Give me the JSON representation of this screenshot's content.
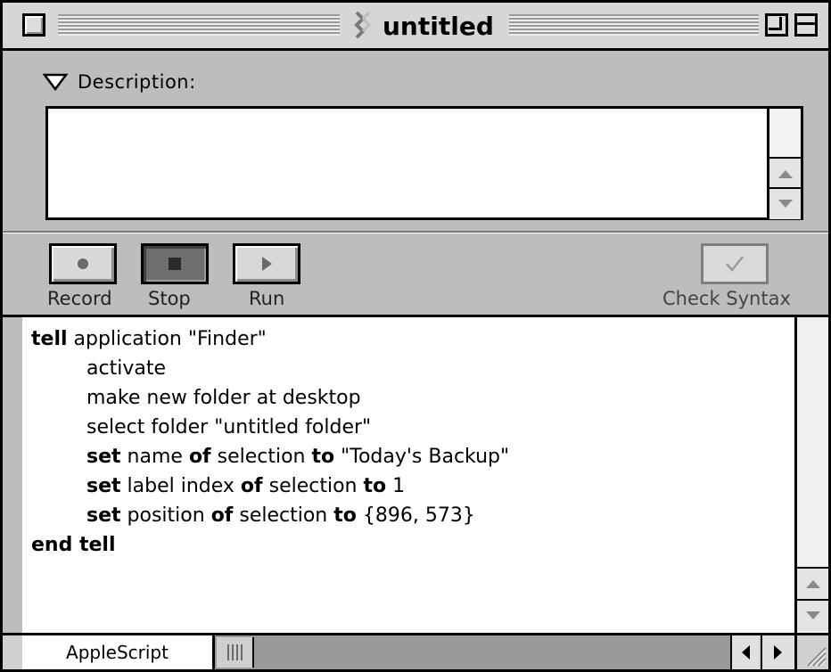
{
  "window": {
    "title": "untitled"
  },
  "description": {
    "label": "Description:",
    "text": ""
  },
  "toolbar": {
    "record_label": "Record",
    "stop_label": "Stop",
    "run_label": "Run",
    "check_syntax_label": "Check Syntax"
  },
  "script": {
    "lines": [
      {
        "indent": 0,
        "tokens": [
          {
            "t": "tell",
            "kw": true
          },
          {
            "t": " application \"Finder\"",
            "kw": false
          }
        ]
      },
      {
        "indent": 1,
        "tokens": [
          {
            "t": "activate",
            "kw": false
          }
        ]
      },
      {
        "indent": 1,
        "tokens": [
          {
            "t": "make new folder at desktop",
            "kw": false
          }
        ]
      },
      {
        "indent": 1,
        "tokens": [
          {
            "t": "select folder \"untitled folder\"",
            "kw": false
          }
        ]
      },
      {
        "indent": 1,
        "tokens": [
          {
            "t": "set",
            "kw": true
          },
          {
            "t": " name ",
            "kw": false
          },
          {
            "t": "of",
            "kw": true
          },
          {
            "t": " selection ",
            "kw": false
          },
          {
            "t": "to",
            "kw": true
          },
          {
            "t": " \"Today's Backup\"",
            "kw": false
          }
        ]
      },
      {
        "indent": 1,
        "tokens": [
          {
            "t": "set",
            "kw": true
          },
          {
            "t": " label index ",
            "kw": false
          },
          {
            "t": "of",
            "kw": true
          },
          {
            "t": " selection ",
            "kw": false
          },
          {
            "t": "to",
            "kw": true
          },
          {
            "t": " 1",
            "kw": false
          }
        ]
      },
      {
        "indent": 1,
        "tokens": [
          {
            "t": "set",
            "kw": true
          },
          {
            "t": " position ",
            "kw": false
          },
          {
            "t": "of",
            "kw": true
          },
          {
            "t": " selection ",
            "kw": false
          },
          {
            "t": "to",
            "kw": true
          },
          {
            "t": " {896, 573}",
            "kw": false
          }
        ]
      },
      {
        "indent": 0,
        "tokens": [
          {
            "t": "end tell",
            "kw": true
          }
        ]
      }
    ]
  },
  "bottom": {
    "language": "AppleScript"
  },
  "icons": {
    "close_box": "close-box-icon",
    "zoom_box": "zoom-box-icon",
    "collapse_box": "collapse-box-icon",
    "script_file": "applescript-file-icon",
    "disclosure": "disclosure-triangle-icon",
    "record": "record-dot-icon",
    "stop": "stop-square-icon",
    "run": "run-triangle-icon",
    "check": "checkmark-icon"
  }
}
